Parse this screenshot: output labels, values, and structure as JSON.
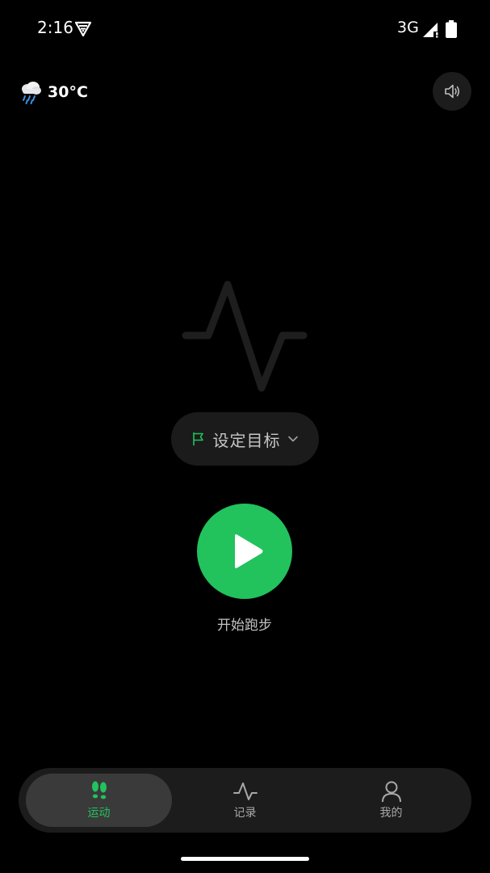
{
  "status_bar": {
    "time": "2:16",
    "network": "3G",
    "vpn_icon": "vpn-key-shield-icon",
    "signal_icon": "signal-icon",
    "battery_icon": "battery-icon"
  },
  "weather": {
    "icon": "rain-cloud-icon",
    "temperature": "30°C"
  },
  "sound": {
    "icon": "speaker-icon"
  },
  "goal": {
    "icon": "flag-icon",
    "label": "设定目标",
    "chevron": "chevron-down-icon"
  },
  "start": {
    "icon": "play-icon",
    "label": "开始跑步"
  },
  "bottom_nav": {
    "items": [
      {
        "label": "运动",
        "icon": "footprints-icon",
        "active": true
      },
      {
        "label": "记录",
        "icon": "pulse-icon",
        "active": false
      },
      {
        "label": "我的",
        "icon": "person-icon",
        "active": false
      }
    ]
  },
  "colors": {
    "background": "#000000",
    "accent": "#22c25d",
    "surface": "#1c1c1c",
    "active_pill": "#3a3a3a",
    "text_muted": "#a8a8a8"
  }
}
